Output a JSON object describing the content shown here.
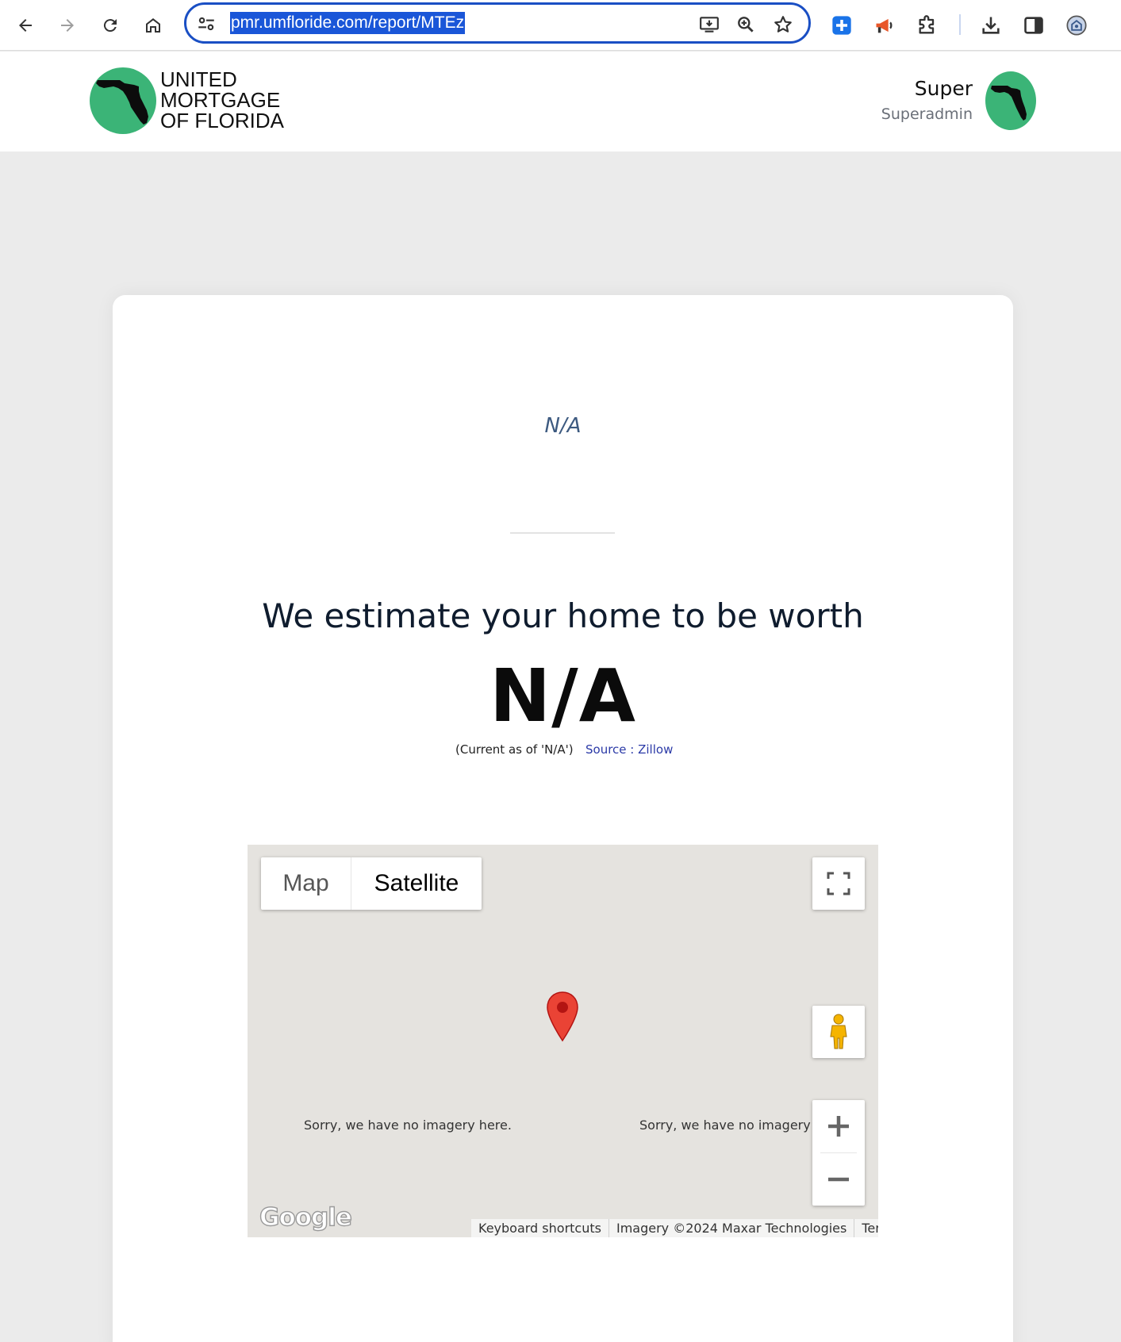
{
  "browser": {
    "url": "pmr.umfloride.com/report/MTEz",
    "accent_color": "#1a56d8",
    "nav_icons": [
      "back-icon",
      "forward-icon",
      "reload-icon",
      "home-icon"
    ],
    "omnibox_icons": [
      "site-settings-icon",
      "install-app-icon",
      "zoom-icon",
      "bookmark-star-icon"
    ],
    "extension_icons": [
      "plus-extension-icon",
      "megaphone-extension-icon",
      "extensions-puzzle-icon",
      "downloads-icon",
      "side-panel-icon",
      "profile-icon"
    ]
  },
  "header": {
    "logo_lines": [
      "UNITED",
      "MORTGAGE",
      "OF FLORIDA"
    ],
    "user_name": "Super",
    "user_role": "Superadmin",
    "brand_color": "#3bb477"
  },
  "report": {
    "address": "N/A",
    "heading": "We estimate your home to be worth",
    "value": "N/A",
    "current_as_of": "(Current as of 'N/A')",
    "source": "Source : Zillow"
  },
  "map": {
    "type_map": "Map",
    "type_satellite": "Satellite",
    "selected_type": "Satellite",
    "no_imagery_1": "Sorry, we have no imagery here.",
    "no_imagery_2": "Sorry, we have no imagery here.",
    "google_logo": "Google",
    "attribution": {
      "shortcuts": "Keyboard shortcuts",
      "imagery": "Imagery ©2024 Maxar Technologies",
      "terms": "Terms"
    }
  }
}
